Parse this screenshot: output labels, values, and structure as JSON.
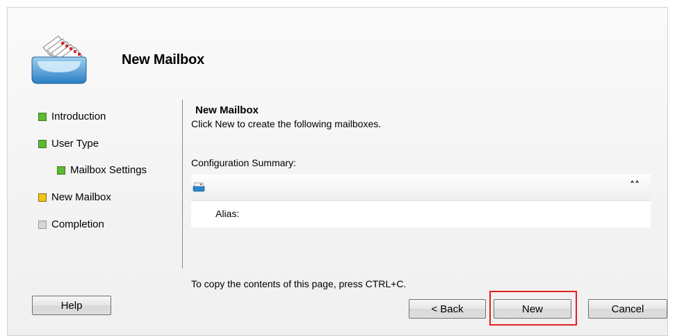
{
  "header": {
    "title": "New Mailbox",
    "icon": "mailbox-icon"
  },
  "steps": [
    {
      "label": "Introduction",
      "state": "completed",
      "color": "#5fb832"
    },
    {
      "label": "User Type",
      "state": "completed",
      "color": "#5fb832"
    },
    {
      "label": "Mailbox Settings",
      "state": "completed",
      "color": "#5fb832"
    },
    {
      "label": "New Mailbox",
      "state": "current",
      "color": "#f0c419"
    },
    {
      "label": "Completion",
      "state": "pending",
      "color": "#c8c8c8"
    }
  ],
  "content": {
    "title": "New Mailbox",
    "subtitle": "Click New to create the following mailboxes.",
    "summary_label": "Configuration Summary:",
    "summary_row": {
      "icon": "mailbox-small-icon",
      "collapse_icon": "double-chevron-up-icon",
      "collapse_glyph": "˄˄",
      "alias_label": "Alias:"
    },
    "copy_hint": "To copy the contents of this page, press CTRL+C."
  },
  "buttons": {
    "help": "Help",
    "back": "< Back",
    "new": "New",
    "cancel": "Cancel"
  },
  "colors": {
    "highlight": "#e3201b"
  }
}
